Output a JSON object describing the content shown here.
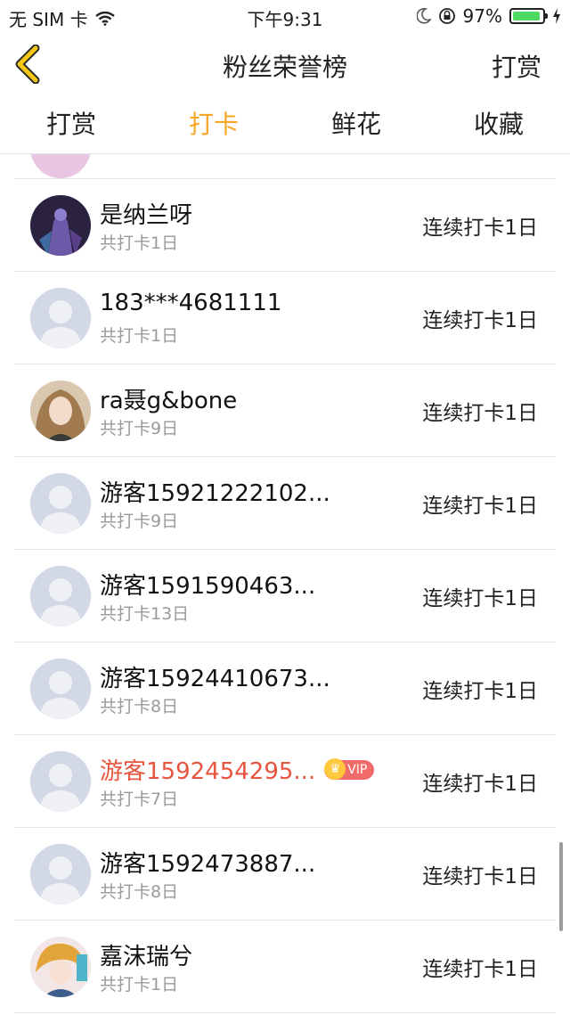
{
  "status_bar": {
    "carrier": "无 SIM 卡",
    "time": "下午9:31",
    "battery": "97%",
    "battery_color": "#4cd964"
  },
  "navbar": {
    "back_icon": "chevron-left-icon",
    "title": "粉丝荣誉榜",
    "right_button": "打赏"
  },
  "tabs": [
    {
      "label": "打赏",
      "active": false
    },
    {
      "label": "打卡",
      "active": true
    },
    {
      "label": "鲜花",
      "active": false
    },
    {
      "label": "收藏",
      "active": false
    }
  ],
  "accent_color": "#f5a623",
  "vip_name_color": "#e8553f",
  "rows": [
    {
      "name": "是纳兰呀",
      "total": "共打卡1日",
      "streak": "连续打卡1日",
      "avatar": "photo"
    },
    {
      "name": "183***4681111",
      "total": "共打卡1日",
      "streak": "连续打卡1日",
      "avatar": "default"
    },
    {
      "name": "ra聂g&bone",
      "total": "共打卡9日",
      "streak": "连续打卡1日",
      "avatar": "photo"
    },
    {
      "name": "游客15921222102...",
      "total": "共打卡9日",
      "streak": "连续打卡1日",
      "avatar": "default"
    },
    {
      "name": "游客1591590463...",
      "total": "共打卡13日",
      "streak": "连续打卡1日",
      "avatar": "default"
    },
    {
      "name": "游客15924410673...",
      "total": "共打卡8日",
      "streak": "连续打卡1日",
      "avatar": "default"
    },
    {
      "name": "游客1592454295...",
      "total": "共打卡7日",
      "streak": "连续打卡1日",
      "avatar": "default",
      "vip": "VIP"
    },
    {
      "name": "游客1592473887...",
      "total": "共打卡8日",
      "streak": "连续打卡1日",
      "avatar": "default"
    },
    {
      "name": "嘉沫瑞兮",
      "total": "共打卡1日",
      "streak": "连续打卡1日",
      "avatar": "photo"
    }
  ]
}
